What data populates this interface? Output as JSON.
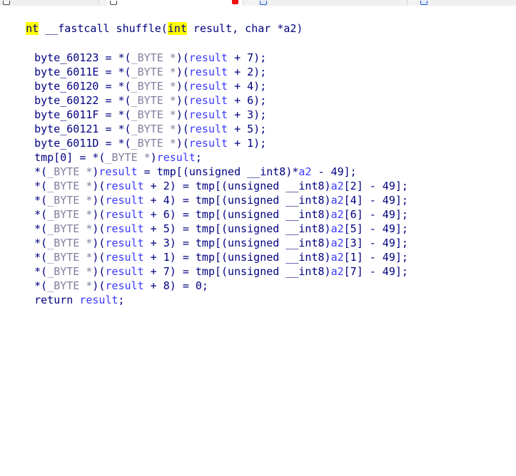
{
  "tabs": [
    {
      "title": "",
      "active": false,
      "icon": "doc-icon",
      "has_close": false
    },
    {
      "title": "",
      "active": true,
      "icon": "doc-icon",
      "has_close": true
    },
    {
      "title": "",
      "active": false,
      "icon": "doc-icon",
      "has_close": false
    },
    {
      "title": "",
      "active": false,
      "icon": "doc-icon",
      "has_close": false
    }
  ],
  "code": {
    "header": {
      "type_left": "nt",
      "text_1": " __fastcall shuffle(",
      "type_param": "int",
      "text_2": " result, char *a2)"
    },
    "lines": [
      {
        "lhs": "byte_60123",
        "op": " = *(",
        "cast": "_BYTE *",
        "mid": ")(",
        "var": "result",
        "rhs": " + 7);"
      },
      {
        "lhs": "byte_6011E",
        "op": " = *(",
        "cast": "_BYTE *",
        "mid": ")(",
        "var": "result",
        "rhs": " + 2);"
      },
      {
        "lhs": "byte_60120",
        "op": " = *(",
        "cast": "_BYTE *",
        "mid": ")(",
        "var": "result",
        "rhs": " + 4);"
      },
      {
        "lhs": "byte_60122",
        "op": " = *(",
        "cast": "_BYTE *",
        "mid": ")(",
        "var": "result",
        "rhs": " + 6);"
      },
      {
        "lhs": "byte_6011F",
        "op": " = *(",
        "cast": "_BYTE *",
        "mid": ")(",
        "var": "result",
        "rhs": " + 3);"
      },
      {
        "lhs": "byte_60121",
        "op": " = *(",
        "cast": "_BYTE *",
        "mid": ")(",
        "var": "result",
        "rhs": " + 5);"
      },
      {
        "lhs": "byte_6011D",
        "op": " = *(",
        "cast": "_BYTE *",
        "mid": ")(",
        "var": "result",
        "rhs": " + 1);"
      }
    ],
    "tmp0": {
      "left": "tmp[0] = *(",
      "cast": "_BYTE *",
      "mid": ")",
      "var": "result",
      "end": ";"
    },
    "assign0": {
      "start": "*(",
      "cast": "_BYTE *",
      "mid": ")",
      "var": "result",
      "rest": " = tmp[(unsigned __int8)*",
      "var2": "a2",
      "end": " - 49];"
    },
    "assigns": [
      {
        "idx": "2",
        "a2idx": "2"
      },
      {
        "idx": "4",
        "a2idx": "4"
      },
      {
        "idx": "6",
        "a2idx": "6"
      },
      {
        "idx": "5",
        "a2idx": "5"
      },
      {
        "idx": "3",
        "a2idx": "3"
      },
      {
        "idx": "1",
        "a2idx": "1"
      },
      {
        "idx": "7",
        "a2idx": "7"
      }
    ],
    "assign_template": {
      "start": "*(",
      "cast": "_BYTE *",
      "mid": ")(",
      "var": "result",
      "plus": " + ",
      "after_idx": ") = tmp[(unsigned __int8)",
      "var2": "a2",
      "bracket_open": "[",
      "bracket_close": "] - 49];"
    },
    "zero_line": {
      "start": "*(",
      "cast": "_BYTE *",
      "mid": ")(",
      "var": "result",
      "rest": " + 8) = 0;"
    },
    "return_line": {
      "kw": "return ",
      "var": "result",
      "end": ";"
    }
  }
}
